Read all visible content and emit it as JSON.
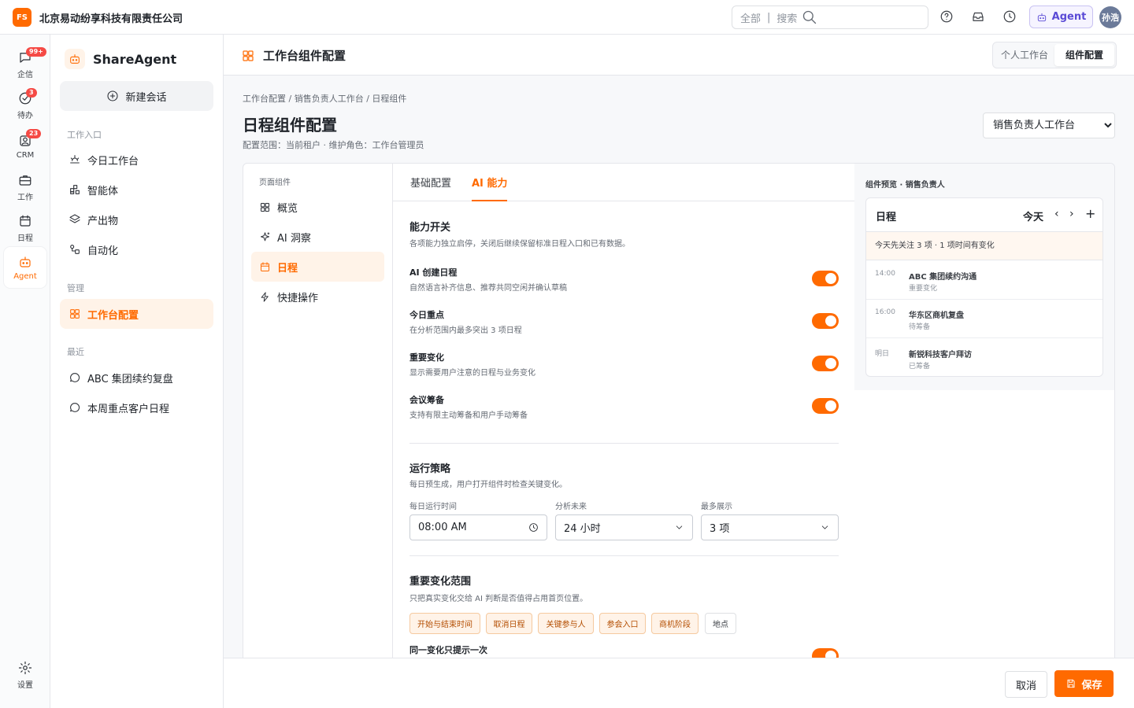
{
  "topbar": {
    "logo": "FS",
    "company": "北京易动纷享科技有限责任公司",
    "search_scope": "全部",
    "search_sep": "|",
    "search_placeholder": "搜索",
    "agent_label": "Agent",
    "avatar_text": "孙浩"
  },
  "rail": {
    "items": [
      {
        "label": "企信",
        "icon": "chat-icon",
        "badge": "99+"
      },
      {
        "label": "待办",
        "icon": "check-circle-icon",
        "badge": "3"
      },
      {
        "label": "CRM",
        "icon": "contacts-icon",
        "badge": "23"
      },
      {
        "label": "工作",
        "icon": "briefcase-icon"
      },
      {
        "label": "日程",
        "icon": "calendar-icon"
      },
      {
        "label": "Agent",
        "icon": "robot-icon",
        "active": true
      }
    ],
    "settings_label": "设置"
  },
  "sidebar": {
    "brand": "ShareAgent",
    "new_chat": "新建会话",
    "section_entry": "工作入口",
    "entry_items": [
      "今日工作台",
      "智能体",
      "产出物",
      "自动化"
    ],
    "section_manage": "管理",
    "manage_items": [
      "工作台配置"
    ],
    "section_recent": "最近",
    "recent_items": [
      "ABC 集团续约复盘",
      "本周重点客户日程"
    ]
  },
  "header": {
    "title": "工作台组件配置",
    "seg_personal": "个人工作台",
    "seg_component": "组件配置"
  },
  "page": {
    "breadcrumb": "工作台配置 / 销售负责人工作台 / 日程组件",
    "title": "日程组件配置",
    "scope": "配置范围：当前租户 · 维护角色：工作台管理员",
    "workspace_select": "销售负责人工作台"
  },
  "left_nav": {
    "title": "页面组件",
    "items": [
      "概览",
      "AI 洞察",
      "日程",
      "快捷操作"
    ],
    "active": "日程"
  },
  "tabs": {
    "basic": "基础配置",
    "ai": "AI 能力",
    "active": "AI 能力"
  },
  "capability": {
    "title": "能力开关",
    "desc": "各项能力独立启停，关闭后继续保留标准日程入口和已有数据。",
    "items": [
      {
        "title": "AI 创建日程",
        "desc": "自然语言补齐信息、推荐共同空闲并确认草稿",
        "enabled": true
      },
      {
        "title": "今日重点",
        "desc": "在分析范围内最多突出 3 项日程",
        "enabled": true
      },
      {
        "title": "重要变化",
        "desc": "显示需要用户注意的日程与业务变化",
        "enabled": true
      },
      {
        "title": "会议筹备",
        "desc": "支持有限主动筹备和用户手动筹备",
        "enabled": true
      }
    ]
  },
  "strategy": {
    "title": "运行策略",
    "desc": "每日预生成，用户打开组件时检查关键变化。",
    "run_time_label": "每日运行时间",
    "run_time_value": "08:00 AM",
    "future_label": "分析未来",
    "future_value": "24 小时",
    "max_label": "最多展示",
    "max_value": "3 项"
  },
  "change_scope": {
    "title": "重要变化范围",
    "desc": "只把真实变化交给 AI 判断是否值得占用首页位置。",
    "chips": [
      {
        "label": "开始与结束时间",
        "selected": true
      },
      {
        "label": "取消日程",
        "selected": true
      },
      {
        "label": "关键参与人",
        "selected": true
      },
      {
        "label": "参会入口",
        "selected": true
      },
      {
        "label": "商机阶段",
        "selected": true
      },
      {
        "label": "地点",
        "selected": false
      }
    ],
    "once_title": "同一变化只提示一次",
    "once_enabled": true
  },
  "preview": {
    "title": "组件预览 · 销售负责人",
    "card_title": "日程",
    "today": "今天",
    "prev": "‹",
    "next": "›",
    "add": "+",
    "focus": "今天先关注 3 项 · 1 项时间有变化",
    "rows": [
      {
        "time": "14:00",
        "name": "ABC 集团续约沟通",
        "sub": "重要变化"
      },
      {
        "time": "16:00",
        "name": "华东区商机复盘",
        "sub": "待筹备"
      },
      {
        "time": "明日",
        "name": "新锐科技客户拜访",
        "sub": "已筹备"
      }
    ]
  },
  "footer": {
    "cancel": "取消",
    "save": "保存"
  },
  "colors": {
    "accent": "#ff6a00",
    "accent_bg": "#fff3e8",
    "agent_purple": "#5b4bd6",
    "badge_red": "#f54a45"
  }
}
